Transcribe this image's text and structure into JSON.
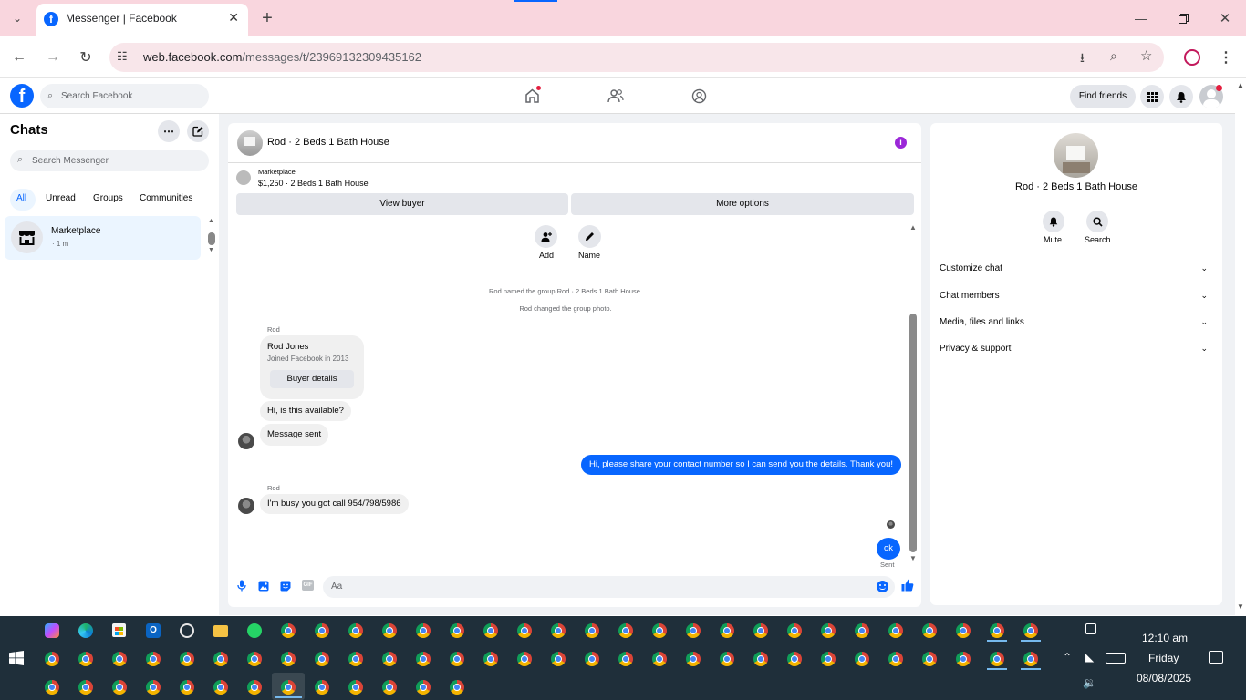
{
  "browser": {
    "tab_title": "Messenger | Facebook",
    "url_host": "web.facebook.com",
    "url_path": "/messages/t/23969132309435162"
  },
  "fb": {
    "search_placeholder": "Search Facebook",
    "find_friends": "Find friends"
  },
  "chats": {
    "title": "Chats",
    "search_placeholder": "Search Messenger",
    "filters": [
      "All",
      "Unread",
      "Groups",
      "Communities"
    ],
    "items": [
      {
        "name": "Marketplace",
        "time": "· 1 m"
      }
    ]
  },
  "conversation": {
    "title": "Rod · 2 Beds 1 Bath House",
    "listing_label": "Marketplace",
    "listing_price_title": "$1,250 · 2 Beds 1 Bath House",
    "view_buyer": "View buyer",
    "more_options": "More options",
    "add_label": "Add",
    "name_label": "Name",
    "system_messages": [
      "Rod named the group Rod · 2 Beds 1 Bath House.",
      "Rod changed the group photo."
    ],
    "sender1": "Rod",
    "card_name": "Rod Jones",
    "card_sub": "Joined Facebook in 2013",
    "card_button": "Buyer details",
    "msg_available": "Hi, is this available?",
    "msg_sent": "Message sent",
    "outgoing1": "Hi, please share your contact number so I can send you the details. Thank you!",
    "sender2": "Rod",
    "msg_busy": "I'm busy you got call 954/798/5986",
    "outgoing2": "ok",
    "status": "Sent",
    "composer_placeholder": "Aa"
  },
  "info": {
    "title": "Rod · 2 Beds 1 Bath House",
    "mute": "Mute",
    "search": "Search",
    "sections": [
      "Customize chat",
      "Chat members",
      "Media, files and links",
      "Privacy & support"
    ]
  },
  "taskbar": {
    "time": "12:10 am",
    "day": "Friday",
    "date": "08/08/2025"
  },
  "colors": {
    "accent": "#0866ff",
    "tabbar": "#f9d6de",
    "taskbar": "#1f2f3a"
  }
}
